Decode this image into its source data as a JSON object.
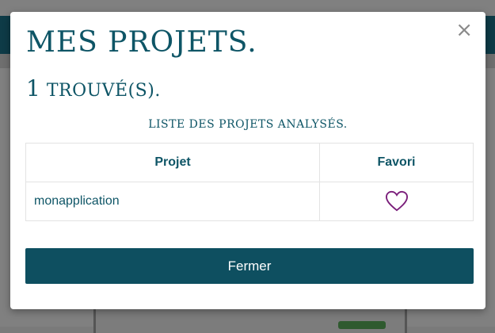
{
  "modal": {
    "title": "MES PROJETS.",
    "count": "1",
    "found_label": "TROUVÉ(S).",
    "caption": "LISTE DES PROJETS ANALYSÉS.",
    "close_symbol": "×",
    "table": {
      "headers": [
        "Projet",
        "Favori"
      ],
      "rows": [
        {
          "project": "monapplication",
          "favorite": false
        }
      ]
    },
    "close_button_label": "Fermer",
    "heart_color": "#7a1e7a",
    "accent_color": "#0e5566"
  }
}
